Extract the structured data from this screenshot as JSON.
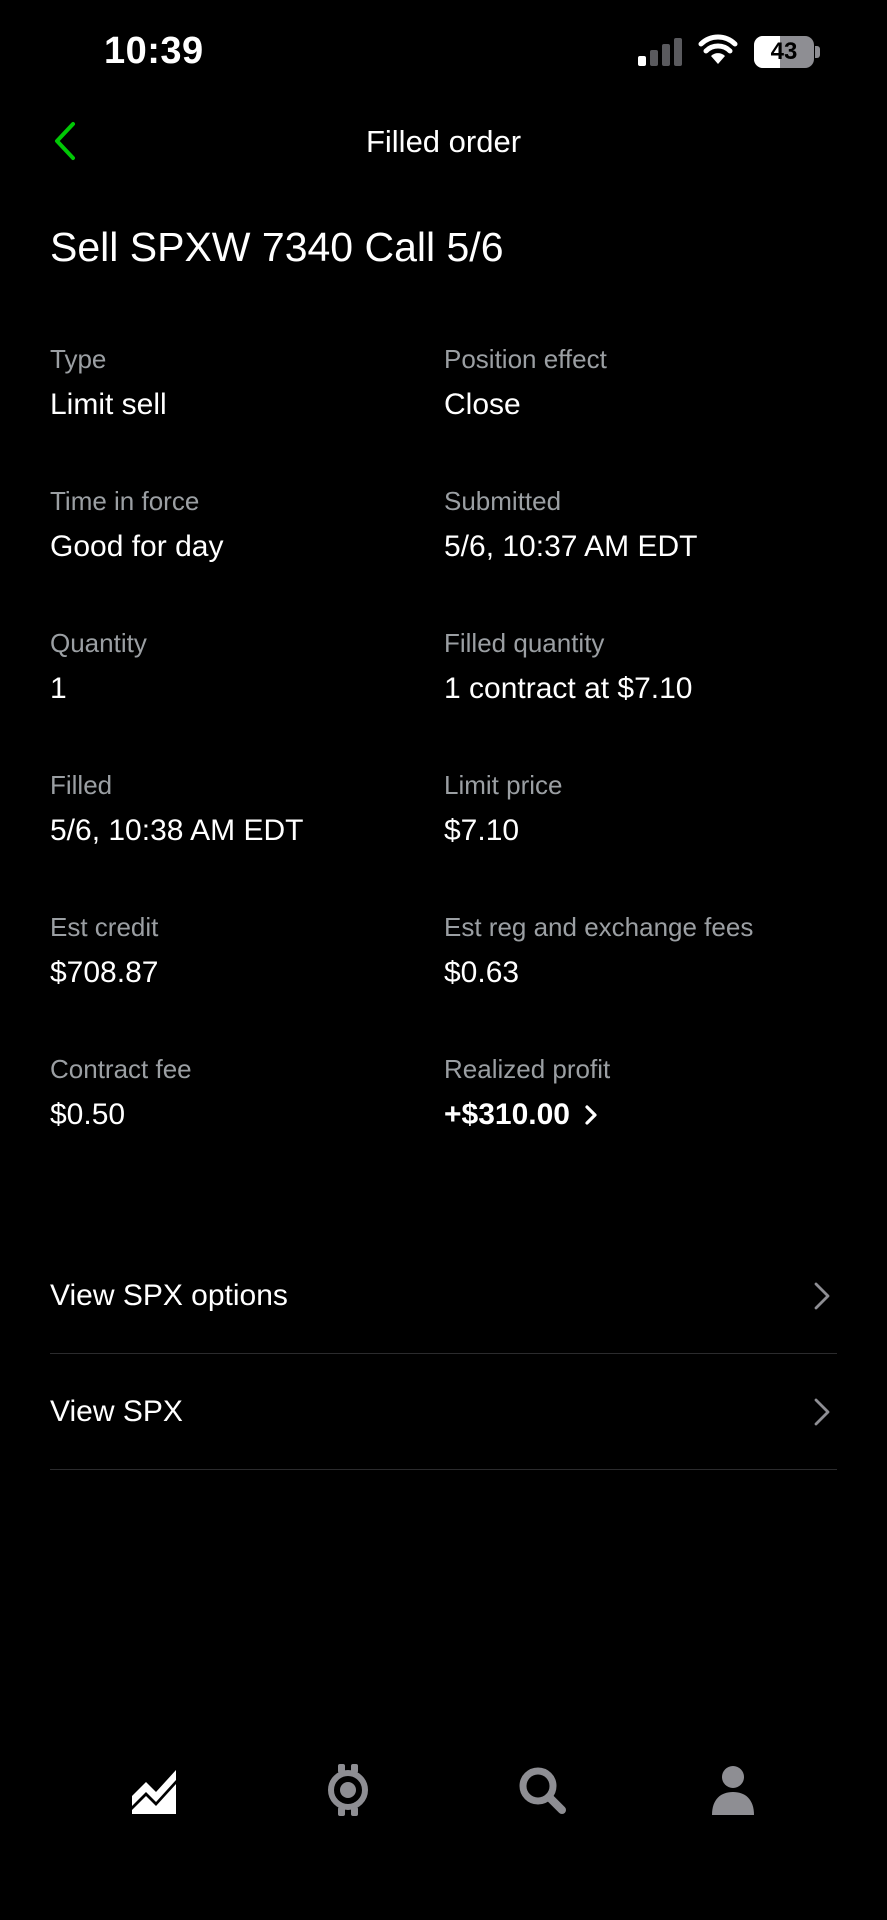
{
  "status_bar": {
    "time": "10:39",
    "signal_icon": "cellular-signal-icon",
    "wifi_icon": "wifi-icon",
    "battery_level": "43",
    "battery_fraction": 0.43
  },
  "header": {
    "back_icon": "chevron-left-icon",
    "title": "Filled order"
  },
  "order": {
    "title": "Sell SPXW 7340 Call 5/6"
  },
  "details": [
    {
      "label": "Type",
      "value": "Limit sell"
    },
    {
      "label": "Position effect",
      "value": "Close"
    },
    {
      "label": "Time in force",
      "value": "Good for day"
    },
    {
      "label": "Submitted",
      "value": "5/6, 10:37 AM EDT"
    },
    {
      "label": "Quantity",
      "value": "1"
    },
    {
      "label": "Filled quantity",
      "value": "1 contract at $7.10"
    },
    {
      "label": "Filled",
      "value": "5/6, 10:38 AM EDT"
    },
    {
      "label": "Limit price",
      "value": "$7.10"
    },
    {
      "label": "Est credit",
      "value": "$708.87"
    },
    {
      "label": "Est reg and exchange fees",
      "value": "$0.63"
    },
    {
      "label": "Contract fee",
      "value": "$0.50"
    },
    {
      "label": "Realized profit",
      "value": "+$310.00"
    }
  ],
  "links": [
    {
      "label": "View SPX options"
    },
    {
      "label": "View SPX"
    }
  ],
  "tab_bar": {
    "tabs": [
      {
        "icon": "investing-chart-icon",
        "active": true
      },
      {
        "icon": "browse-compass-icon",
        "active": false
      },
      {
        "icon": "search-icon",
        "active": false
      },
      {
        "icon": "account-person-icon",
        "active": false
      }
    ]
  },
  "colors": {
    "accent": "#00c805",
    "background": "#000000",
    "label_gray": "#9b9fa3",
    "divider": "#2b2b2d",
    "inactive_tab": "#8e8e93"
  }
}
